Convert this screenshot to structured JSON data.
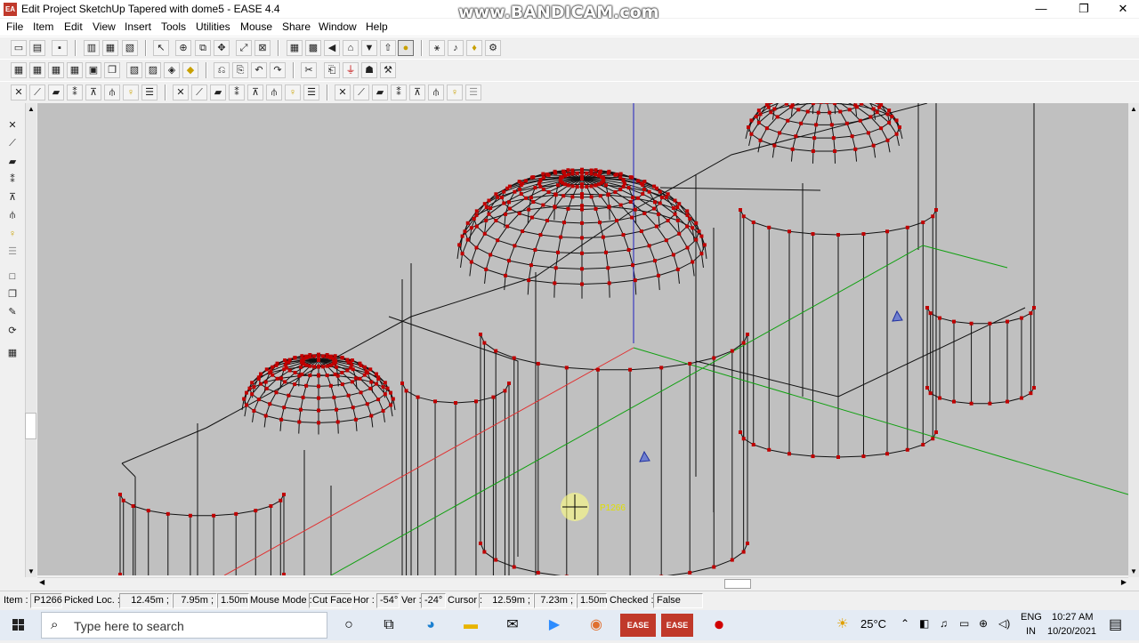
{
  "window": {
    "title": "Edit Project SketchUp Tapered with dome5 - EASE 4.4",
    "app_icon_text": "EA",
    "watermark": "www.BANDICAM.com",
    "controls": {
      "minimize": "—",
      "maximize": "❐",
      "close": "✕"
    }
  },
  "menu": [
    "File",
    "Item",
    "Edit",
    "View",
    "Insert",
    "Tools",
    "Utilities",
    "Mouse",
    "Share",
    "Window",
    "Help"
  ],
  "toolbar_icons": {
    "row1": [
      "open-icon",
      "print-preview-icon",
      "save-icon",
      "print-icon",
      "print-setup-icon",
      "export-icon",
      "pointer-icon",
      "target-icon",
      "copy-view-icon",
      "move-icon",
      "zoom-extents-icon",
      "zoom-window-icon",
      "grid-icon",
      "grid-alt-icon",
      "arrow-left-icon",
      "home-icon",
      "arrow-down-icon",
      "up-icon",
      "sun-icon",
      "render-icon",
      "speaker-icon",
      "light-icon",
      "settings-icon"
    ],
    "row2": [
      "view-top-icon",
      "view-front-icon",
      "view-side-icon",
      "view-grid-icon",
      "view-box-icon",
      "view-layers-icon",
      "view-3d-icon",
      "view-iso-icon",
      "view-persp-icon",
      "refresh-icon",
      "undo-icon",
      "redo-icon",
      "cut-icon",
      "paste-icon",
      "fill-icon",
      "group-icon",
      "plug-icon"
    ],
    "row3": [
      "close-icon",
      "edit-line-icon",
      "face-icon",
      "split-icon",
      "wall-icon",
      "pin-icon",
      "light-bulb-icon",
      "sliders-icon",
      "cross-icon",
      "line-icon",
      "face-fill-icon",
      "split-2-icon",
      "plane-icon",
      "pin-2-icon",
      "bulb-2-icon",
      "sliders-2-icon",
      "cross-2-icon",
      "line-2-icon",
      "face-2-icon",
      "split-3-icon",
      "plane-2-icon",
      "pin-3-icon",
      "bulb-3-icon",
      "sliders-3-icon"
    ]
  },
  "left_toolbar": [
    "delete-vertex-icon",
    "edit-vertex-icon",
    "face-tool-icon",
    "split-tool-icon",
    "wall-tool-icon",
    "column-tool-icon",
    "light-tool-icon",
    "filter-tool-icon",
    "box-tool-icon",
    "cube-tool-icon",
    "edit-tool-icon",
    "rotate-tool-icon",
    "grid-tool-icon"
  ],
  "cursor_label": "P1266",
  "status": {
    "item_label": "Item :",
    "item_value": "P1266",
    "picked_label": "Picked Loc. :",
    "picked_x": "12.45m ;",
    "picked_y": "7.95m ;",
    "picked_z": "1.50m",
    "mode_label": "Mouse Mode :",
    "mode_value": "Cut Face",
    "hor_label": "Hor :",
    "hor_value": "-54°",
    "ver_label": "Ver :",
    "ver_value": "-24°",
    "cursor_label": "Cursor :",
    "cursor_x": "12.59m ;",
    "cursor_y": "7.23m ;",
    "cursor_z": "1.50m",
    "checked_label": "Checked :",
    "checked_value": "False"
  },
  "taskbar": {
    "search_placeholder": "Type here to search",
    "weather": "25°C",
    "lang_top": "ENG",
    "lang_bottom": "IN",
    "time": "10:27 AM",
    "date": "10/20/2021",
    "ease_label": "EASE"
  },
  "colors": {
    "viewport": "#c0c0c0",
    "vertex": "#c00000",
    "wire": "#111111",
    "axis_x": "#e03030",
    "axis_y": "#10a010",
    "axis_z": "#2020c0"
  }
}
